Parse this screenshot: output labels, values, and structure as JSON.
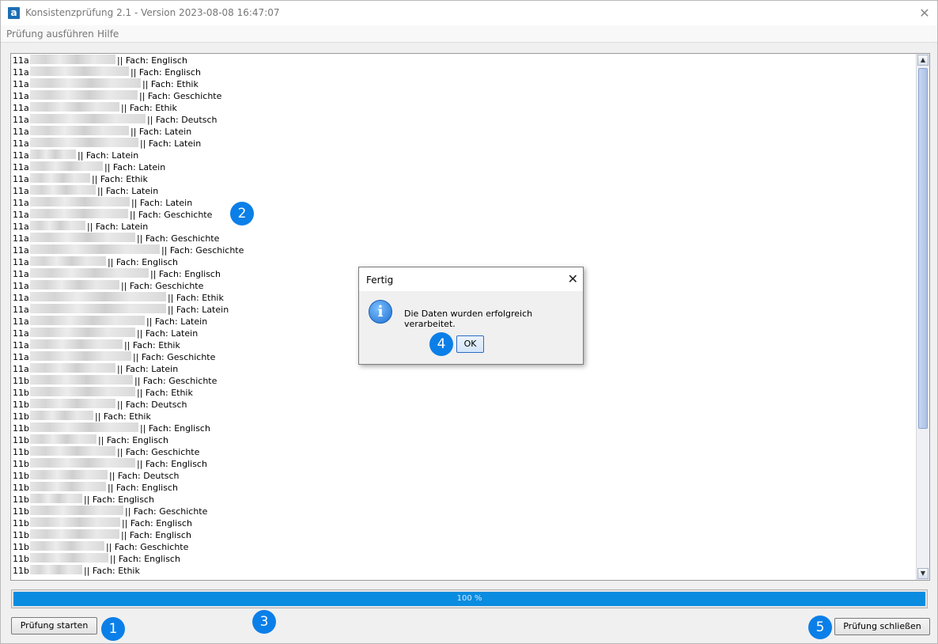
{
  "window": {
    "title": "Konsistenzprüfung 2.1 - Version 2023-08-08 16:47:07",
    "app_icon_letter": "a",
    "close_glyph": "✕"
  },
  "menu": [
    "Prüfung ausführen",
    "Hilfe"
  ],
  "log": {
    "lines": [
      {
        "class": "11a",
        "subject": "|| Fach: Englisch"
      },
      {
        "class": "11a",
        "subject": "|| Fach: Englisch"
      },
      {
        "class": "11a",
        "subject": "|| Fach: Ethik"
      },
      {
        "class": "11a",
        "subject": "|| Fach: Geschichte"
      },
      {
        "class": "11a",
        "subject": "|| Fach: Ethik"
      },
      {
        "class": "11a",
        "subject": "|| Fach: Deutsch"
      },
      {
        "class": "11a",
        "subject": "|| Fach: Latein"
      },
      {
        "class": "11a",
        "subject": "|| Fach: Latein"
      },
      {
        "class": "11a",
        "subject": "|| Fach: Latein"
      },
      {
        "class": "11a",
        "subject": "|| Fach: Latein"
      },
      {
        "class": "11a",
        "subject": "|| Fach: Ethik"
      },
      {
        "class": "11a",
        "subject": "|| Fach: Latein"
      },
      {
        "class": "11a",
        "subject": "|| Fach: Latein"
      },
      {
        "class": "11a",
        "subject": "|| Fach: Geschichte"
      },
      {
        "class": "11a",
        "subject": "|| Fach: Latein"
      },
      {
        "class": "11a",
        "subject": "|| Fach: Geschichte"
      },
      {
        "class": "11a",
        "subject": "|| Fach: Geschichte"
      },
      {
        "class": "11a",
        "subject": "|| Fach: Englisch"
      },
      {
        "class": "11a",
        "subject": "|| Fach: Englisch"
      },
      {
        "class": "11a",
        "subject": "|| Fach: Geschichte"
      },
      {
        "class": "11a",
        "subject": "|| Fach: Ethik"
      },
      {
        "class": "11a",
        "subject": "|| Fach: Latein"
      },
      {
        "class": "11a",
        "subject": "|| Fach: Latein"
      },
      {
        "class": "11a",
        "subject": "|| Fach: Latein"
      },
      {
        "class": "11a",
        "subject": "|| Fach: Ethik"
      },
      {
        "class": "11a",
        "subject": "|| Fach: Geschichte"
      },
      {
        "class": "11a",
        "subject": "|| Fach: Latein"
      },
      {
        "class": "11b",
        "subject": "|| Fach: Geschichte"
      },
      {
        "class": "11b",
        "subject": "|| Fach: Ethik"
      },
      {
        "class": "11b",
        "subject": "|| Fach: Deutsch"
      },
      {
        "class": "11b",
        "subject": "|| Fach: Ethik"
      },
      {
        "class": "11b",
        "subject": "|| Fach: Englisch"
      },
      {
        "class": "11b",
        "subject": "|| Fach: Englisch"
      },
      {
        "class": "11b",
        "subject": "|| Fach: Geschichte"
      },
      {
        "class": "11b",
        "subject": "|| Fach: Englisch"
      },
      {
        "class": "11b",
        "subject": "|| Fach: Deutsch"
      },
      {
        "class": "11b",
        "subject": "|| Fach: Englisch"
      },
      {
        "class": "11b",
        "subject": "|| Fach: Englisch"
      },
      {
        "class": "11b",
        "subject": "|| Fach: Geschichte"
      },
      {
        "class": "11b",
        "subject": "|| Fach: Englisch"
      },
      {
        "class": "11b",
        "subject": "|| Fach: Englisch"
      },
      {
        "class": "11b",
        "subject": "|| Fach: Geschichte"
      },
      {
        "class": "11b",
        "subject": "|| Fach: Englisch"
      },
      {
        "class": "11b",
        "subject": "|| Fach: Ethik"
      }
    ]
  },
  "progress": {
    "value": 1.0,
    "label": "100 %"
  },
  "buttons": {
    "start": "Prüfung starten",
    "close": "Prüfung schließen"
  },
  "dialog": {
    "title": "Fertig",
    "close_glyph": "✕",
    "message": "Die Daten wurden erfolgreich verarbeitet.",
    "ok": "OK",
    "icon_glyph": "i"
  },
  "badges": [
    "1",
    "2",
    "3",
    "4",
    "5"
  ],
  "colors": {
    "accent": "#0b7fe8",
    "progress": "#0a8ce0"
  }
}
